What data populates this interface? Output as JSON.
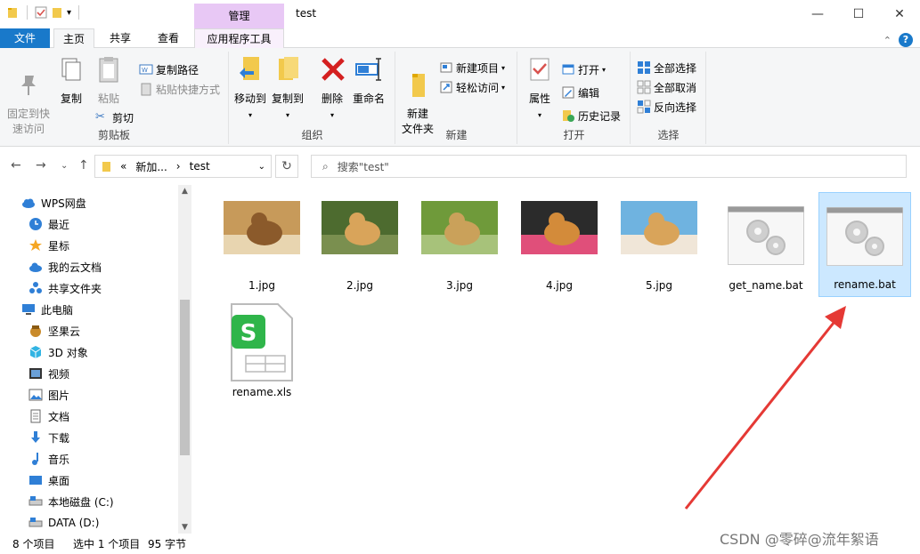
{
  "window": {
    "title": "test",
    "manage_tab": "管理",
    "controls": {
      "minimize": "—",
      "maximize": "☐",
      "close": "✕"
    }
  },
  "tabs": {
    "file": "文件",
    "home": "主页",
    "share": "共享",
    "view": "查看",
    "apptools": "应用程序工具"
  },
  "ribbon": {
    "clipboard": {
      "label": "剪贴板",
      "pin": "固定到快\n速访问",
      "copy": "复制",
      "paste": "粘贴",
      "copy_path": "复制路径",
      "paste_shortcut": "粘贴快捷方式",
      "cut": "剪切"
    },
    "organize": {
      "label": "组织",
      "move_to": "移动到",
      "copy_to": "复制到",
      "delete": "删除",
      "rename": "重命名"
    },
    "new": {
      "label": "新建",
      "new_folder": "新建\n文件夹",
      "new_item": "新建项目",
      "easy_access": "轻松访问"
    },
    "open": {
      "label": "打开",
      "properties": "属性",
      "open": "打开",
      "edit": "编辑",
      "history": "历史记录"
    },
    "select": {
      "label": "选择",
      "select_all": "全部选择",
      "select_none": "全部取消",
      "invert": "反向选择"
    }
  },
  "address": {
    "crumbs": [
      "«",
      "新加...",
      "›",
      "test"
    ],
    "search_placeholder": "搜索\"test\""
  },
  "nav": [
    {
      "label": "WPS网盘",
      "icon": "cloud-icon",
      "indent": 0
    },
    {
      "label": "最近",
      "icon": "clock-icon",
      "indent": 1
    },
    {
      "label": "星标",
      "icon": "star-icon",
      "indent": 1
    },
    {
      "label": "我的云文档",
      "icon": "cloud-doc-icon",
      "indent": 1
    },
    {
      "label": "共享文件夹",
      "icon": "share-folder-icon",
      "indent": 1
    },
    {
      "label": "此电脑",
      "icon": "computer-icon",
      "indent": 0
    },
    {
      "label": "坚果云",
      "icon": "nut-icon",
      "indent": 1
    },
    {
      "label": "3D 对象",
      "icon": "cube-icon",
      "indent": 1
    },
    {
      "label": "视频",
      "icon": "video-icon",
      "indent": 1
    },
    {
      "label": "图片",
      "icon": "picture-icon",
      "indent": 1
    },
    {
      "label": "文档",
      "icon": "document-icon",
      "indent": 1
    },
    {
      "label": "下载",
      "icon": "download-icon",
      "indent": 1
    },
    {
      "label": "音乐",
      "icon": "music-icon",
      "indent": 1
    },
    {
      "label": "桌面",
      "icon": "desktop-icon",
      "indent": 1
    },
    {
      "label": "本地磁盘 (C:)",
      "icon": "drive-icon",
      "indent": 1
    },
    {
      "label": "DATA (D:)",
      "icon": "drive-icon",
      "indent": 1
    }
  ],
  "files": [
    {
      "name": "1.jpg",
      "type": "image"
    },
    {
      "name": "2.jpg",
      "type": "image"
    },
    {
      "name": "3.jpg",
      "type": "image"
    },
    {
      "name": "4.jpg",
      "type": "image"
    },
    {
      "name": "5.jpg",
      "type": "image"
    },
    {
      "name": "get_name.bat",
      "type": "bat"
    },
    {
      "name": "rename.bat",
      "type": "bat",
      "selected": true
    },
    {
      "name": "rename.xls",
      "type": "xls"
    }
  ],
  "status": {
    "count": "8 个项目",
    "selected": "选中 1 个项目",
    "size": "95 字节"
  },
  "watermark": "CSDN @零碎@流年絮语",
  "colors": {
    "accent": "#1979ca",
    "manage": "#e8c8f5",
    "selection": "#cce8ff",
    "arrow": "#e53935"
  }
}
